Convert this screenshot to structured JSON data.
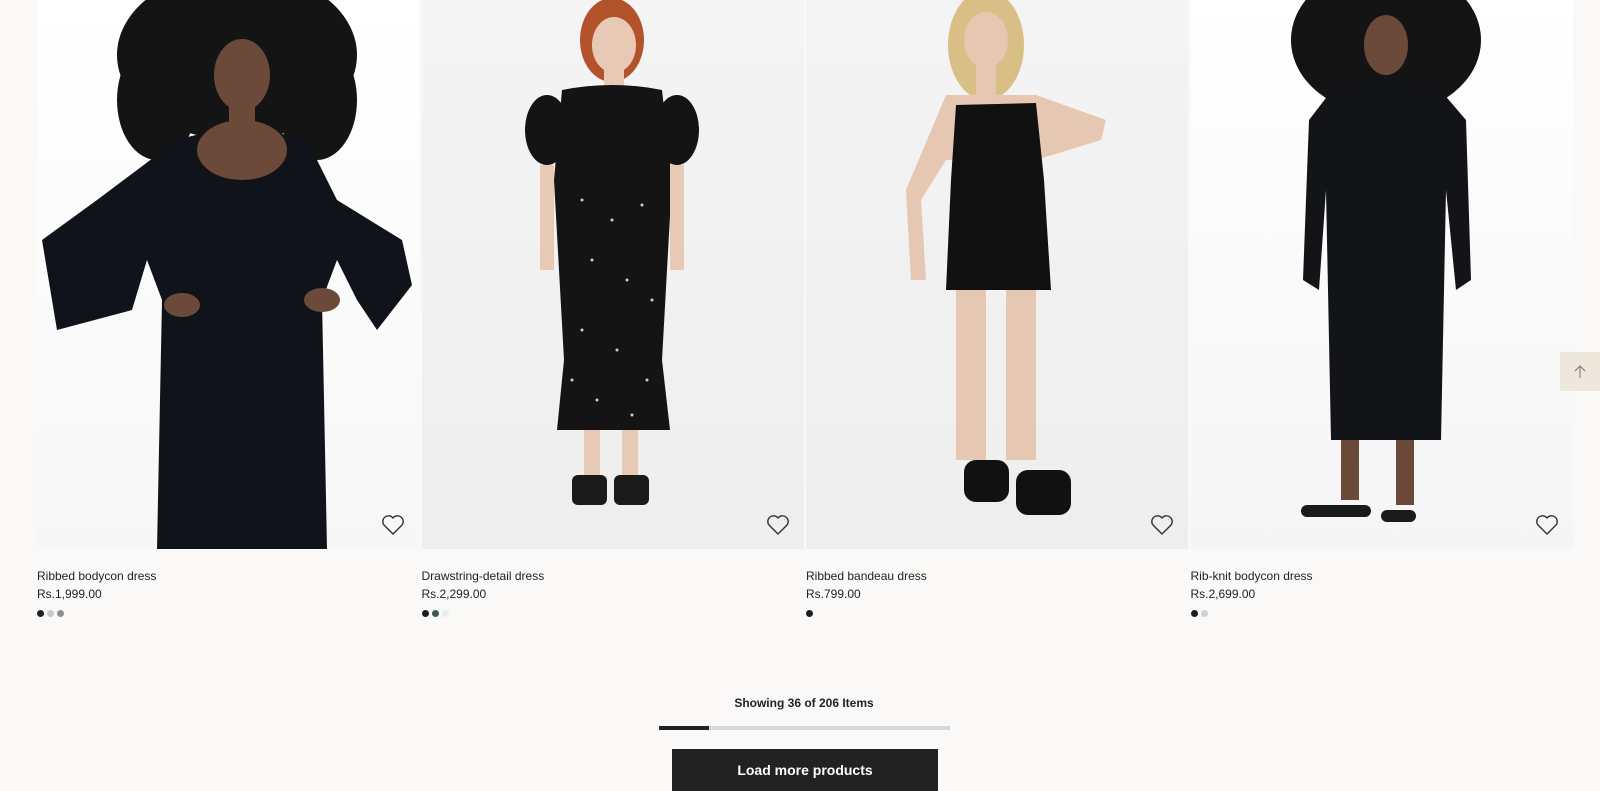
{
  "products": [
    {
      "title": "Ribbed bodycon dress",
      "price": "Rs.1,999.00",
      "swatches": [
        "#222222",
        "#c9c9c9",
        "#8f8f8f"
      ],
      "image_desc": "model-black-long-sleeve-ribbed-dress"
    },
    {
      "title": "Drawstring-detail dress",
      "price": "Rs.2,299.00",
      "swatches": [
        "#1e1e1e",
        "#3e5a52",
        "#ececec"
      ],
      "image_desc": "model-black-dotted-puff-sleeve-dress"
    },
    {
      "title": "Ribbed bandeau dress",
      "price": "Rs.799.00",
      "swatches": [
        "#1e1e1e"
      ],
      "image_desc": "model-black-strapless-mini-dress"
    },
    {
      "title": "Rib-knit bodycon dress",
      "price": "Rs.2,699.00",
      "swatches": [
        "#1e1e1e",
        "#d2d2d2"
      ],
      "image_desc": "model-black-knit-midi-dress"
    }
  ],
  "pagination": {
    "count_text": "Showing 36 of 206 Items",
    "shown": 36,
    "total": 206,
    "load_more_label": "Load more products"
  },
  "icons": {
    "favorite": "heart-icon",
    "back_to_top": "arrow-up-icon"
  }
}
